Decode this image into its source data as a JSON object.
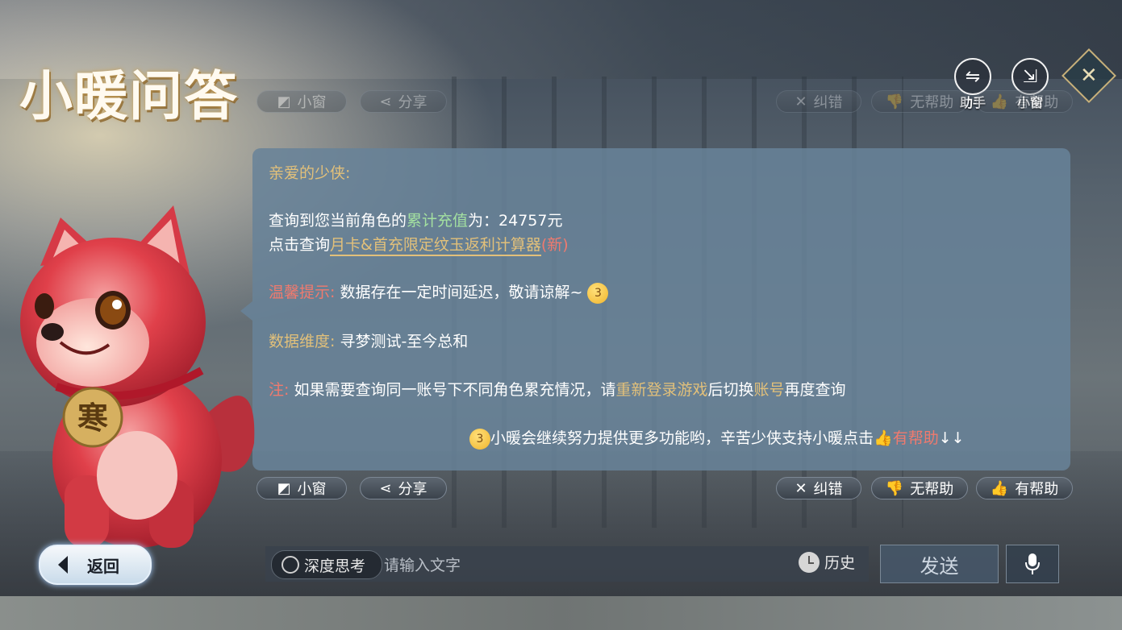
{
  "title": "小暖问答",
  "top_buttons": {
    "assistant_label": "助手",
    "small_window_label": "小窗"
  },
  "action_bar": {
    "small_window": "小窗",
    "share": "分享",
    "correct": "纠错",
    "not_helpful": "无帮助",
    "helpful": "有帮助"
  },
  "message": {
    "greeting": "亲爱的少侠:",
    "recharge_prefix": "查询到您当前角色的",
    "recharge_highlight": "累计充值",
    "recharge_suffix": "为：24757元",
    "click_prefix": "点击查询",
    "calc_link": "月卡&首充限定纹玉返利计算器",
    "calc_new": "(新)",
    "tip_label": "温馨提示:",
    "tip_text": "数据存在一定时间延迟，敬请谅解~",
    "dimension_label": "数据维度:",
    "dimension_text": "寻梦测试-至今总和",
    "note_label": "注:",
    "note_text1": "如果需要查询同一账号下不同角色累充情况，请",
    "note_highlight1": "重新登录游戏",
    "note_text2": "后切换",
    "note_highlight2": "账号",
    "note_text3": "再度查询",
    "closing_text": "小暖会继续努力提供更多功能哟，辛苦少侠支持小暖点击",
    "closing_highlight": "有帮助",
    "closing_arrows": "↓↓"
  },
  "mascot": {
    "tag_char": "寒"
  },
  "bottom": {
    "back_label": "返回",
    "deep_think_label": "深度思考",
    "input_placeholder": "请输入文字",
    "history_label": "历史",
    "send_label": "发送"
  },
  "colors": {
    "gold": "#e2c07a",
    "green": "#a3e0a0",
    "red": "#f07a6e",
    "card": "#6882a0"
  }
}
